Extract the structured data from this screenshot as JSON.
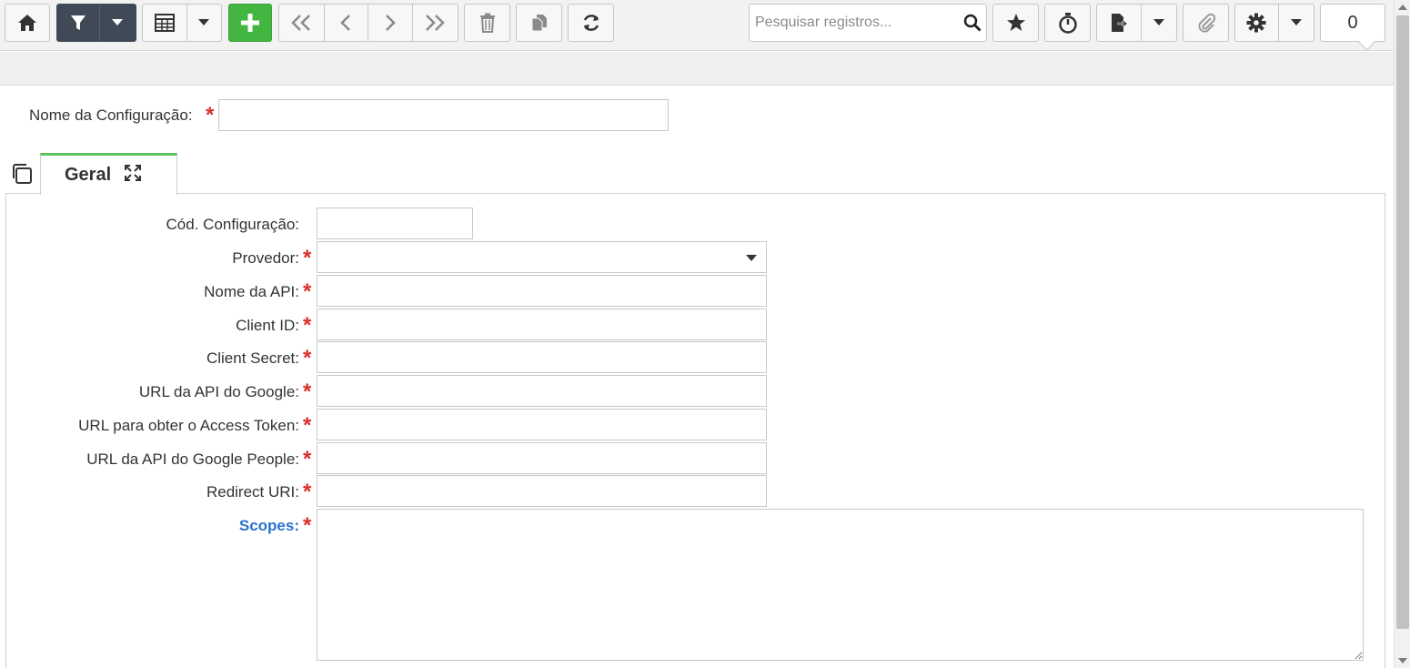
{
  "toolbar": {
    "buttons": {
      "home": "home-icon",
      "filter": "filter-icon",
      "grid": "grid-icon",
      "add": "plus-icon",
      "first": "double-chevron-left-icon",
      "prev": "chevron-left-icon",
      "next": "chevron-right-icon",
      "last": "double-chevron-right-icon",
      "delete": "trash-icon",
      "copy": "copy-icon",
      "refresh": "refresh-icon",
      "favorite": "star-icon",
      "timer": "stopwatch-icon",
      "export": "export-icon",
      "attach": "paperclip-icon",
      "settings": "gear-icon"
    },
    "search_placeholder": "Pesquisar registros...",
    "counter": "0"
  },
  "form": {
    "config_name_label": "Nome da Configuração:",
    "config_name_value": "",
    "tab_label": "Geral",
    "fields": [
      {
        "label": "Cód. Configuração:",
        "value": "",
        "required": false
      },
      {
        "label": "Provedor:",
        "value": "",
        "required": true
      },
      {
        "label": "Nome da API:",
        "value": "",
        "required": true
      },
      {
        "label": "Client ID:",
        "value": "",
        "required": true
      },
      {
        "label": "Client Secret:",
        "value": "",
        "required": true
      },
      {
        "label": "URL da API do Google:",
        "value": "",
        "required": true
      },
      {
        "label": "URL para obter o Access Token:",
        "value": "",
        "required": true
      },
      {
        "label": "URL da API do Google People:",
        "value": "",
        "required": true
      },
      {
        "label": "Redirect URI:",
        "value": "",
        "required": true
      },
      {
        "label": "Scopes:",
        "value": "",
        "required": true
      }
    ],
    "required_mark": "*"
  },
  "colors": {
    "accent_green": "#43b642",
    "dark_button": "#3f4a56",
    "required": "#d9302c",
    "link_label": "#2a72d2"
  }
}
